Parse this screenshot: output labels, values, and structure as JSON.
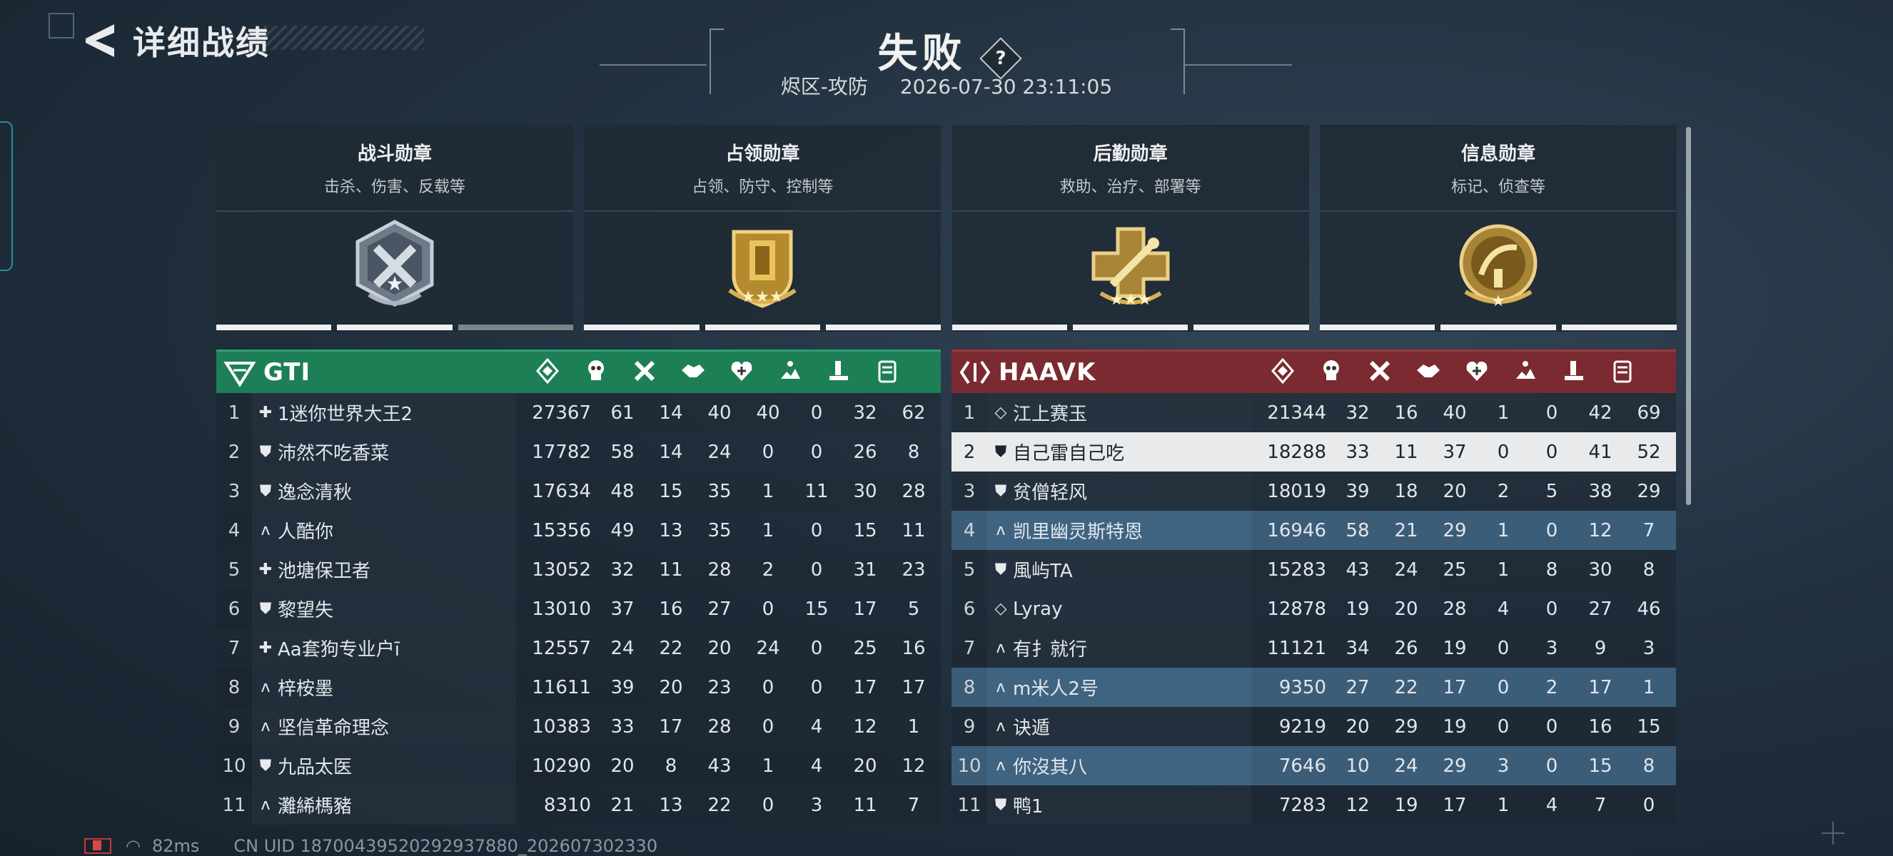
{
  "header": {
    "back_title": "详细战绩",
    "result": "失败",
    "help": "?",
    "mode": "烬区-攻防",
    "datetime": "2026-07-30 23:11:05"
  },
  "medals": [
    {
      "title": "战斗勋章",
      "desc": "击杀、伤害、反载等",
      "icon": "combat-medal-icon",
      "progress_filled": 2,
      "progress_total": 3
    },
    {
      "title": "占领勋章",
      "desc": "占领、防守、控制等",
      "icon": "capture-medal-icon",
      "progress_filled": 3,
      "progress_total": 3
    },
    {
      "title": "后勤勋章",
      "desc": "救助、治疗、部署等",
      "icon": "logistics-medal-icon",
      "progress_filled": 3,
      "progress_total": 3
    },
    {
      "title": "信息勋章",
      "desc": "标记、侦查等",
      "icon": "intel-medal-icon",
      "progress_filled": 3,
      "progress_total": 3
    }
  ],
  "stat_icons": [
    "score-icon",
    "kill-icon",
    "cross-icon",
    "handshake-icon",
    "heart-icon",
    "capture-icon",
    "deploy-icon",
    "intel-icon"
  ],
  "teams": {
    "left": {
      "name": "GTI",
      "color": "#1d7f55",
      "players": [
        {
          "rank": "1",
          "cls": "✚",
          "name": "1迷你世界大王2",
          "score": "27367",
          "stats": [
            "61",
            "14",
            "40",
            "40",
            "0",
            "32",
            "62"
          ]
        },
        {
          "rank": "2",
          "cls": "⛊",
          "name": "沛然不吃香菜",
          "score": "17782",
          "stats": [
            "58",
            "14",
            "24",
            "0",
            "0",
            "26",
            "8"
          ]
        },
        {
          "rank": "3",
          "cls": "⛊",
          "name": "逸念清秋",
          "score": "17634",
          "stats": [
            "48",
            "15",
            "35",
            "1",
            "11",
            "30",
            "28"
          ]
        },
        {
          "rank": "4",
          "cls": "ʌ",
          "name": "人酷你",
          "score": "15356",
          "stats": [
            "49",
            "13",
            "35",
            "1",
            "0",
            "15",
            "11"
          ]
        },
        {
          "rank": "5",
          "cls": "✚",
          "name": "池塘保卫者",
          "score": "13052",
          "stats": [
            "32",
            "11",
            "28",
            "2",
            "0",
            "31",
            "23"
          ]
        },
        {
          "rank": "6",
          "cls": "⛊",
          "name": "黎望失",
          "score": "13010",
          "stats": [
            "37",
            "16",
            "27",
            "0",
            "15",
            "17",
            "5"
          ]
        },
        {
          "rank": "7",
          "cls": "✚",
          "name": "Aa套狗专业户ī",
          "score": "12557",
          "stats": [
            "24",
            "22",
            "20",
            "24",
            "0",
            "25",
            "16"
          ]
        },
        {
          "rank": "8",
          "cls": "ʌ",
          "name": "梓桉墨",
          "score": "11611",
          "stats": [
            "39",
            "20",
            "23",
            "0",
            "0",
            "17",
            "17"
          ]
        },
        {
          "rank": "9",
          "cls": "ʌ",
          "name": "坚信革命理念",
          "score": "10383",
          "stats": [
            "33",
            "17",
            "28",
            "0",
            "4",
            "12",
            "1"
          ]
        },
        {
          "rank": "10",
          "cls": "⛊",
          "name": "九品太医",
          "score": "10290",
          "stats": [
            "20",
            "8",
            "43",
            "1",
            "4",
            "20",
            "12"
          ]
        },
        {
          "rank": "11",
          "cls": "ʌ",
          "name": "灘絺榪豬",
          "score": "8310",
          "stats": [
            "21",
            "13",
            "22",
            "0",
            "3",
            "11",
            "7"
          ]
        }
      ]
    },
    "right": {
      "name": "HAAVK",
      "color": "#7a2a30",
      "players": [
        {
          "rank": "1",
          "cls": "◇",
          "name": "江上赛玉",
          "score": "21344",
          "stats": [
            "32",
            "16",
            "40",
            "1",
            "0",
            "42",
            "69"
          ],
          "style": ""
        },
        {
          "rank": "2",
          "cls": "⛊",
          "name": "自己雷自己吃",
          "score": "18288",
          "stats": [
            "33",
            "11",
            "37",
            "0",
            "0",
            "41",
            "52"
          ],
          "style": "hl"
        },
        {
          "rank": "3",
          "cls": "⛊",
          "name": "贫僧轻风",
          "score": "18019",
          "stats": [
            "39",
            "18",
            "20",
            "2",
            "5",
            "38",
            "29"
          ],
          "style": ""
        },
        {
          "rank": "4",
          "cls": "ʌ",
          "name": "凯里幽灵斯特恩",
          "score": "16946",
          "stats": [
            "58",
            "21",
            "29",
            "1",
            "0",
            "12",
            "7"
          ],
          "style": "party"
        },
        {
          "rank": "5",
          "cls": "⛊",
          "name": "風屿TA",
          "score": "15283",
          "stats": [
            "43",
            "24",
            "25",
            "1",
            "8",
            "30",
            "8"
          ],
          "style": ""
        },
        {
          "rank": "6",
          "cls": "◇",
          "name": "Lyray",
          "score": "12878",
          "stats": [
            "19",
            "20",
            "28",
            "4",
            "0",
            "27",
            "46"
          ],
          "style": ""
        },
        {
          "rank": "7",
          "cls": "ʌ",
          "name": "有扌就行",
          "score": "11121",
          "stats": [
            "34",
            "26",
            "19",
            "0",
            "3",
            "9",
            "3"
          ],
          "style": ""
        },
        {
          "rank": "8",
          "cls": "ʌ",
          "name": "m米人2号",
          "score": "9350",
          "stats": [
            "27",
            "22",
            "17",
            "0",
            "2",
            "17",
            "1"
          ],
          "style": "party"
        },
        {
          "rank": "9",
          "cls": "ʌ",
          "name": "诀遁",
          "score": "9219",
          "stats": [
            "20",
            "29",
            "19",
            "0",
            "0",
            "16",
            "15"
          ],
          "style": ""
        },
        {
          "rank": "10",
          "cls": "ʌ",
          "name": "你沒其八",
          "score": "7646",
          "stats": [
            "10",
            "24",
            "29",
            "3",
            "0",
            "15",
            "8"
          ],
          "style": "party"
        },
        {
          "rank": "11",
          "cls": "⛊",
          "name": "鸭1",
          "score": "7283",
          "stats": [
            "12",
            "19",
            "17",
            "1",
            "4",
            "7",
            "0"
          ],
          "style": ""
        }
      ]
    }
  },
  "footer": {
    "ping": "82ms",
    "uid": "CN UID 18700439520292937880_202607302330"
  }
}
